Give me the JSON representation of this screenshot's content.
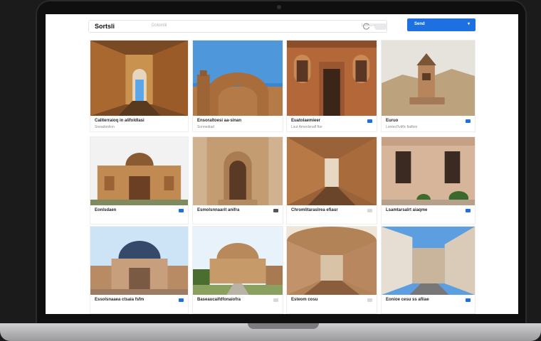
{
  "app": {
    "logo": "Sortsli",
    "search_placeholder": "Dolomlii",
    "search_caption": "Lsteoner",
    "send_label": "Send",
    "send_chevron": "▾"
  },
  "cards": [
    {
      "title": "Caliterraioq in alifoldlasi",
      "subtitle": "Sneadonlion",
      "icon_color": "#d8d8da"
    },
    {
      "title": "Ensoraltoesi aa-sinan",
      "subtitle": "Sonnediad",
      "icon_color": "#d8d8da"
    },
    {
      "title": "Euatolaemieer",
      "subtitle": "Lsut Amenlsnalf ftor",
      "icon_color": "#1e6fe0"
    },
    {
      "title": "Euruo",
      "subtitle": "Lontecl'lvitfic fiatfoni",
      "icon_color": "#1e6fe0"
    },
    {
      "title": "Eonlsdaen",
      "subtitle": "",
      "icon_color": "#1e6fe0"
    },
    {
      "title": "Esmolsnnaarit anifra",
      "subtitle": "",
      "icon_color": "#555558"
    },
    {
      "title": "Chromlitaraslrea efiaur",
      "subtitle": "",
      "icon_color": "#d8d8da"
    },
    {
      "title": "Lsamtarsalrt aiaqme",
      "subtitle": "",
      "icon_color": "#1e6fe0"
    },
    {
      "title": "Essolsnaaea ctsaia fsfm",
      "subtitle": "",
      "icon_color": "#1e6fe0"
    },
    {
      "title": "Baseaucaifdfonaiofra",
      "subtitle": "",
      "icon_color": "#d8d8da"
    },
    {
      "title": "Esteom cosu",
      "subtitle": "",
      "icon_color": "#d8d8da"
    },
    {
      "title": "Eonioe cesu ss afiiae",
      "subtitle": "",
      "icon_color": "#1e6fe0"
    }
  ],
  "colors": {
    "accent": "#1e6fe0"
  }
}
